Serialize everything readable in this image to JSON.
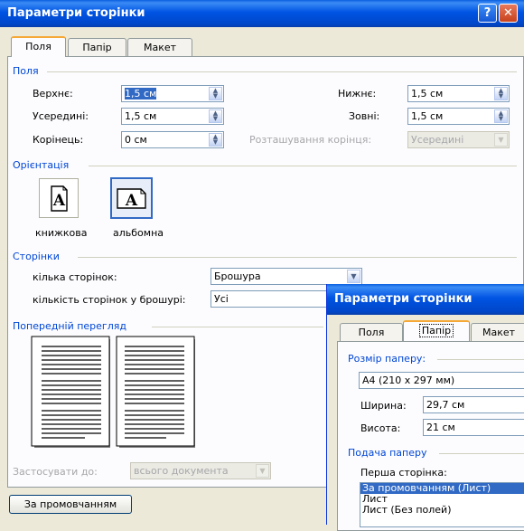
{
  "dialog1": {
    "title": "Параметри сторінки",
    "tabs": [
      "Поля",
      "Папір",
      "Макет"
    ],
    "margins_group": "Поля",
    "top_label": "Верхнє:",
    "top_value": "1,5 см",
    "bottom_label": "Нижнє:",
    "bottom_value": "1,5 см",
    "inside_label": "Усередині:",
    "inside_value": "1,5 см",
    "outside_label": "Зовні:",
    "outside_value": "1,5 см",
    "gutter_label": "Корінець:",
    "gutter_value": "0 см",
    "gutter_pos_label": "Розташування корінця:",
    "gutter_pos_value": "Усередині",
    "orientation_group": "Орієнтація",
    "portrait_label": "книжкова",
    "landscape_label": "альбомна",
    "pages_group": "Сторінки",
    "multiple_pages_label": "кілька сторінок:",
    "multiple_pages_value": "Брошура",
    "sheets_label": "кількість сторінок у брошурі:",
    "sheets_value": "Усі",
    "preview_group": "Попередній перегляд",
    "apply_label": "Застосувати до:",
    "apply_value": "всього документа",
    "default_button": "За промовчанням"
  },
  "dialog2": {
    "title": "Параметри сторінки",
    "tabs": [
      "Поля",
      "Папір",
      "Макет"
    ],
    "paper_size_group": "Розмір паперу:",
    "paper_size_value": "А4 (210 x 297 мм)",
    "width_label": "Ширина:",
    "width_value": "29,7 см",
    "height_label": "Висота:",
    "height_value": "21 см",
    "paper_source_group": "Подача паперу",
    "first_page_label": "Перша сторінка:",
    "first_page_options": [
      "За промовчанням (Лист)",
      "Лист",
      "Лист (Без полей)"
    ]
  },
  "colors": {
    "titlebar": "#0054e3",
    "group_label": "#0046d5",
    "dialog_bg": "#ece9d8",
    "selection": "#316ac5"
  }
}
